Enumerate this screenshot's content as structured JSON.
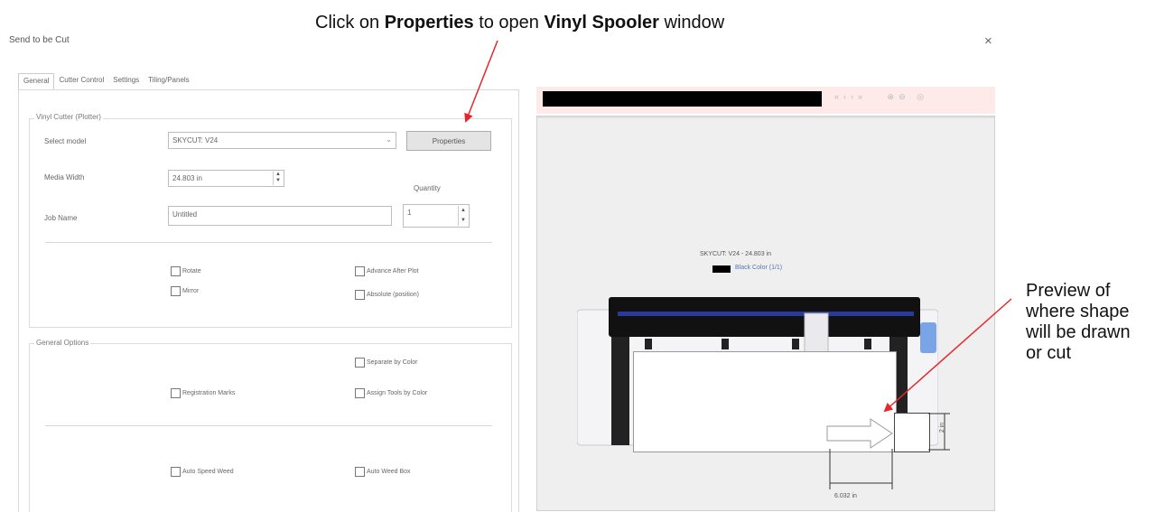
{
  "annotations": {
    "top_pre": "Click on ",
    "top_bold1": "Properties",
    "top_mid": " to open ",
    "top_bold2": "Vinyl Spooler",
    "top_post": " window",
    "right_line1": "Preview of",
    "right_line2": "where shape",
    "right_line3": "will be drawn",
    "right_line4": "or cut",
    "arrow_color": "#e8262a"
  },
  "window": {
    "title": "Send to be Cut",
    "close": "×"
  },
  "tabs": [
    "General",
    "Cutter Control",
    "Settings",
    "Tiling/Panels"
  ],
  "vinyl_cutter": {
    "group_label": "Vinyl Cutter (Plotter)",
    "select_model_label": "Select model",
    "select_model_value": "SKYCUT: V24",
    "properties_button": "Properties",
    "media_width_label": "Media Width",
    "media_width_value": "24.803 in",
    "quantity_label": "Quantity",
    "job_name_label": "Job Name",
    "job_name_value": "Untitled",
    "quantity_value": "1",
    "rotate": "Rotate",
    "mirror": "Mirror",
    "advance_after_plot": "Advance After Plot",
    "absolute_position": "Absolute (position)"
  },
  "general_options": {
    "group_label": "General Options",
    "separate_by_color": "Separate by Color",
    "registration_marks": "Registration Marks",
    "assign_tools_by_color": "Assign Tools by Color",
    "auto_speed_weed": "Auto Speed Weed",
    "auto_weed_box": "Auto Weed Box"
  },
  "preview": {
    "model_info": "SKYCUT: V24 - 24.803 in",
    "color_label": "Black Color (1/1)",
    "swatch_color": "#000000",
    "dim_width": "6.032 in",
    "dim_height": "2 in"
  }
}
